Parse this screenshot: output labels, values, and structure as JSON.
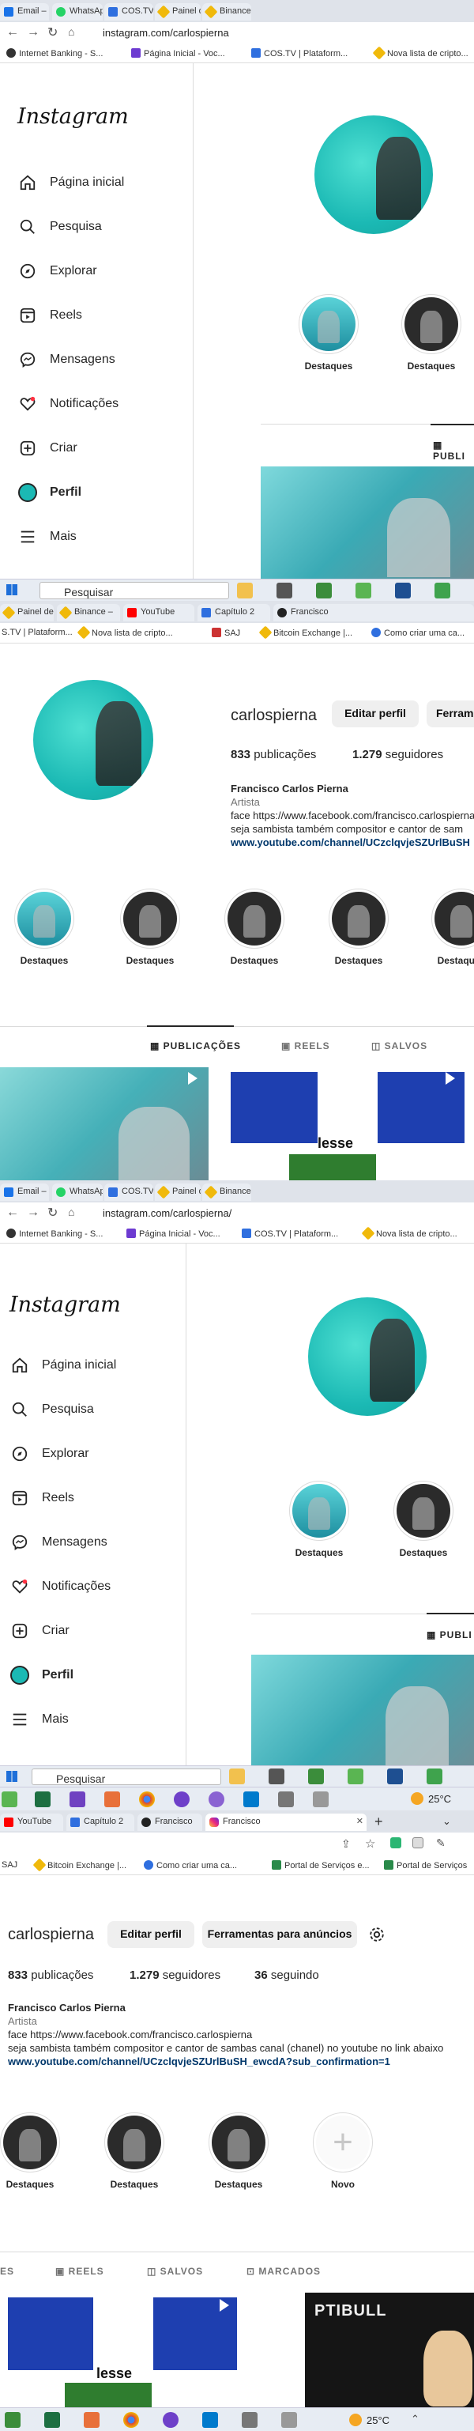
{
  "browser": {
    "tabs_top": [
      "Email – Fl",
      "WhatsApp",
      "COS.TV | C",
      "Painel de",
      "Binance –"
    ],
    "tabs_mid": [
      "Painel de",
      "Binance –",
      "YouTube",
      "Capítulo 2",
      "Francisco"
    ],
    "tabs_bottom": [
      "YouTube",
      "Capítulo 2",
      "Francisco",
      "Francisco"
    ],
    "url": "instagram.com/carlospierna",
    "url_alt": "instagram.com/carlospierna/",
    "bookmarks_a": [
      "Internet Banking - S...",
      "Página Inicial - Voc...",
      "COS.TV | Plataform...",
      "Nova lista de cripto..."
    ],
    "bookmarks_b": [
      "S.TV | Plataform...",
      "Nova lista de cripto...",
      "SAJ",
      "Bitcoin Exchange |...",
      "Como criar uma ca..."
    ],
    "bookmarks_c": [
      "SAJ",
      "Bitcoin Exchange |...",
      "Como criar uma ca...",
      "Portal de Serviços e...",
      "Portal de Serviços"
    ],
    "new_tab": "+"
  },
  "sidebar": {
    "logo": "Instagram",
    "items": [
      {
        "label": "Página inicial",
        "icon": "home-icon"
      },
      {
        "label": "Pesquisa",
        "icon": "search-icon"
      },
      {
        "label": "Explorar",
        "icon": "compass-icon"
      },
      {
        "label": "Reels",
        "icon": "reels-icon"
      },
      {
        "label": "Mensagens",
        "icon": "messenger-icon"
      },
      {
        "label": "Notificações",
        "icon": "heart-icon"
      },
      {
        "label": "Criar",
        "icon": "plus-square-icon"
      },
      {
        "label": "Perfil",
        "icon": "profile-avatar-icon"
      },
      {
        "label": "Mais",
        "icon": "menu-icon"
      }
    ]
  },
  "profile": {
    "username": "carlospierna",
    "edit_button": "Editar perfil",
    "ads_button": "Ferramentas para anúncios",
    "ads_button_short": "Ferrame",
    "posts_count": "833",
    "posts_label": "publicações",
    "followers_count": "1.279",
    "followers_label": "seguidores",
    "following_count": "36",
    "following_label": "seguindo",
    "full_name": "Francisco Carlos Pierna",
    "category": "Artista",
    "bio_line1": "face https://www.facebook.com/francisco.carlospierna",
    "bio_line2": "seja sambista também compositor e cantor de sambas canal (chanel) no youtube no link abaixo",
    "bio_line2_short": "seja sambista também compositor e cantor de sam",
    "bio_link": "www.youtube.com/channel/UCzclqvjeSZUrlBuSH_ewcdA?sub_confirmation=1",
    "bio_link_short": "www.youtube.com/channel/UCzclqvjeSZUrlBuSH"
  },
  "highlights": {
    "label": "Destaques",
    "new_label": "Novo"
  },
  "post_tabs": {
    "publications": "PUBLICAÇÕES",
    "publications_short": "PUBLI",
    "reels": "REELS",
    "saved": "SALVOS",
    "tagged": "MARCADOS",
    "es_fragment": "ES"
  },
  "posts": {
    "caption_lesse": "lesse",
    "caption_ptibull": "PTIBULL"
  },
  "taskbar": {
    "search_placeholder": "Pesquisar",
    "temperature": "25°C"
  },
  "colors": {
    "instagram_text": "#262626",
    "link": "#00376b",
    "avatar_teal": "#1bb9b4"
  }
}
